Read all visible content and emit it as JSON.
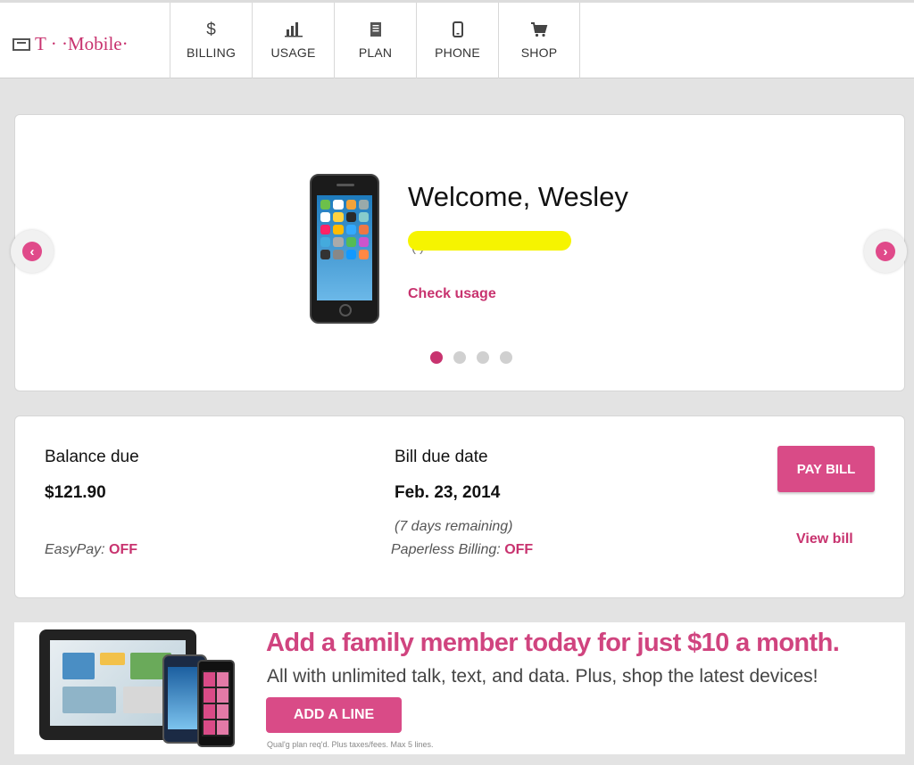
{
  "header": {
    "logo_text": "T · ·Mobile·",
    "nav": [
      {
        "label": "BILLING",
        "icon": "dollar-icon",
        "glyph": "$"
      },
      {
        "label": "USAGE",
        "icon": "bar-chart-icon",
        "glyph": "▐▌"
      },
      {
        "label": "PLAN",
        "icon": "document-icon",
        "glyph": "☰"
      },
      {
        "label": "PHONE",
        "icon": "phone-icon",
        "glyph": "▯"
      },
      {
        "label": "SHOP",
        "icon": "cart-icon",
        "glyph": "⛟"
      }
    ]
  },
  "hero": {
    "welcome": "Welcome, Wesley",
    "phone_number_fragment": "(       )",
    "check_usage": "Check usage",
    "carousel_slides": 4,
    "active_slide": 1,
    "prev_icon": "chevron-left-icon",
    "next_icon": "chevron-right-icon"
  },
  "billing": {
    "balance_label": "Balance due",
    "balance_value": "$121.90",
    "easypay_label": "EasyPay:",
    "easypay_value": "OFF",
    "due_label": "Bill due date",
    "due_value": "Feb. 23, 2014",
    "days_remaining": "(7 days remaining)",
    "paperless_label": "Paperless Billing:",
    "paperless_value": "OFF",
    "pay_button": "PAY BILL",
    "view_bill": "View bill"
  },
  "promo": {
    "headline": "Add a family member today for just $10 a month.",
    "subline": "All with unlimited talk, text, and data. Plus, shop the latest devices!",
    "button": "ADD A LINE",
    "fine_print": "Qual'g plan req'd. Plus taxes/fees. Max 5 lines."
  },
  "colors": {
    "accent": "#c8336f",
    "button": "#d94b87",
    "highlight": "#f6f400",
    "background": "#e3e3e3"
  }
}
